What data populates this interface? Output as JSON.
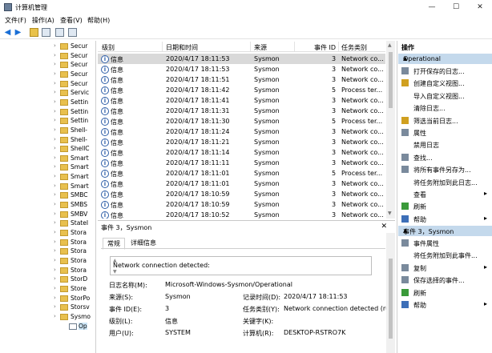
{
  "window": {
    "title": "计算机管理",
    "minimize": "—",
    "maximize": "☐",
    "close": "✕"
  },
  "menu": [
    "文件(F)",
    "操作(A)",
    "查看(V)",
    "帮助(H)"
  ],
  "tree": {
    "items": [
      "Secur",
      "Secur",
      "Secur",
      "Secur",
      "Secur",
      "Servic",
      "Settin",
      "Settin",
      "Settin",
      "Shell-",
      "Shell-",
      "ShellC",
      "Smart",
      "Smart",
      "Smart",
      "Smart",
      "SMBC",
      "SMBS",
      "SMBV",
      "StateI",
      "Stora",
      "Stora",
      "Stora",
      "Stora",
      "Stora",
      "StorD",
      "Store",
      "StorPo",
      "Storsv",
      "Sysmo"
    ],
    "selected": "Op"
  },
  "events": {
    "columns": [
      "级别",
      "日期和时间",
      "来源",
      "事件 ID",
      "任务类别"
    ],
    "rows": [
      {
        "level": "信息",
        "datetime": "2020/4/17 18:11:53",
        "source": "Sysmon",
        "id": "3",
        "task": "Network co..."
      },
      {
        "level": "信息",
        "datetime": "2020/4/17 18:11:53",
        "source": "Sysmon",
        "id": "3",
        "task": "Network co..."
      },
      {
        "level": "信息",
        "datetime": "2020/4/17 18:11:51",
        "source": "Sysmon",
        "id": "3",
        "task": "Network co..."
      },
      {
        "level": "信息",
        "datetime": "2020/4/17 18:11:42",
        "source": "Sysmon",
        "id": "5",
        "task": "Process ter..."
      },
      {
        "level": "信息",
        "datetime": "2020/4/17 18:11:41",
        "source": "Sysmon",
        "id": "3",
        "task": "Network co..."
      },
      {
        "level": "信息",
        "datetime": "2020/4/17 18:11:31",
        "source": "Sysmon",
        "id": "3",
        "task": "Network co..."
      },
      {
        "level": "信息",
        "datetime": "2020/4/17 18:11:30",
        "source": "Sysmon",
        "id": "5",
        "task": "Process ter..."
      },
      {
        "level": "信息",
        "datetime": "2020/4/17 18:11:24",
        "source": "Sysmon",
        "id": "3",
        "task": "Network co..."
      },
      {
        "level": "信息",
        "datetime": "2020/4/17 18:11:21",
        "source": "Sysmon",
        "id": "3",
        "task": "Network co..."
      },
      {
        "level": "信息",
        "datetime": "2020/4/17 18:11:14",
        "source": "Sysmon",
        "id": "3",
        "task": "Network co..."
      },
      {
        "level": "信息",
        "datetime": "2020/4/17 18:11:11",
        "source": "Sysmon",
        "id": "3",
        "task": "Network co..."
      },
      {
        "level": "信息",
        "datetime": "2020/4/17 18:11:01",
        "source": "Sysmon",
        "id": "5",
        "task": "Process ter..."
      },
      {
        "level": "信息",
        "datetime": "2020/4/17 18:11:01",
        "source": "Sysmon",
        "id": "3",
        "task": "Network co..."
      },
      {
        "level": "信息",
        "datetime": "2020/4/17 18:10:59",
        "source": "Sysmon",
        "id": "3",
        "task": "Network co..."
      },
      {
        "level": "信息",
        "datetime": "2020/4/17 18:10:59",
        "source": "Sysmon",
        "id": "3",
        "task": "Network co..."
      },
      {
        "level": "信息",
        "datetime": "2020/4/17 18:10:52",
        "source": "Sysmon",
        "id": "3",
        "task": "Network co..."
      }
    ]
  },
  "detail": {
    "title": "事件 3，Sysmon",
    "close": "✕",
    "tabs": [
      "常规",
      "详细信息"
    ],
    "message": "Network connection detected:",
    "fields": {
      "log_name_label": "日志名称(M):",
      "log_name": "Microsoft-Windows-Sysmon/Operational",
      "source_label": "来源(S):",
      "source": "Sysmon",
      "logged_label": "记录时间(D):",
      "logged": "2020/4/17 18:11:53",
      "event_id_label": "事件 ID(E):",
      "event_id": "3",
      "task_label": "任务类别(Y):",
      "task": "Network connection detected (ru",
      "level_label": "级别(L):",
      "level": "信息",
      "keywords_label": "关键字(K):",
      "keywords": "",
      "user_label": "用户(U):",
      "user": "SYSTEM",
      "computer_label": "计算机(R):",
      "computer": "DESKTOP-RSTRO7K"
    }
  },
  "actions": {
    "header": "操作",
    "section1": "Operational",
    "items1": [
      "打开保存的日志...",
      "创建自定义视图...",
      "导入自定义视图...",
      "清除日志...",
      "筛选当前日志...",
      "属性",
      "禁用日志",
      "查找...",
      "将所有事件另存为...",
      "将任务附加到此日志...",
      "查看",
      "刷新",
      "帮助"
    ],
    "section2": "事件 3，Sysmon",
    "items2": [
      "事件属性",
      "将任务附加到此事件...",
      "复制",
      "保存选择的事件...",
      "刷新",
      "帮助"
    ]
  }
}
